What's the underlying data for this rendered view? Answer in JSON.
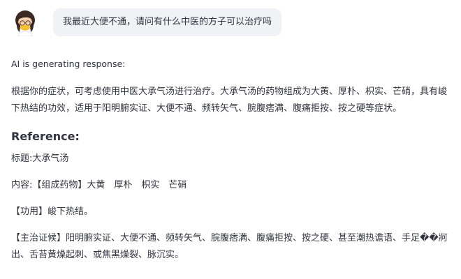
{
  "user": {
    "avatar_icon": "user-avatar-icon",
    "message": "我最近大便不通，请问有什么中医的方子可以治疗吗"
  },
  "assistant": {
    "status": "AI is generating response:",
    "answer": "根据你的症状，可考虑使用中医大承气汤进行治疗。大承气汤的药物组成为大黄、厚朴、枳实、芒硝，具有峻下热结的功效，适用于阳明腑实证、大便不通、频转矢气、脘腹痞满、腹痛拒按、按之硬等症状。",
    "reference_heading": "Reference:",
    "reference": {
      "title": "标题:大承气汤",
      "content": "内容:【组成药物】大黄　厚朴　枳实　芒硝",
      "function": "【功用】峻下热结。",
      "indication": "【主治证候】阳明腑实证、大便不通、频转矢气、脘腹痞满、腹痛拒按、按之硬、甚至潮热谵语、手足��牁出、舌苔黄燥起刺、或焦黑燥裂、脉沉实。"
    }
  },
  "colors": {
    "bubble_bg": "#f0f2f6",
    "text": "#31333f"
  }
}
